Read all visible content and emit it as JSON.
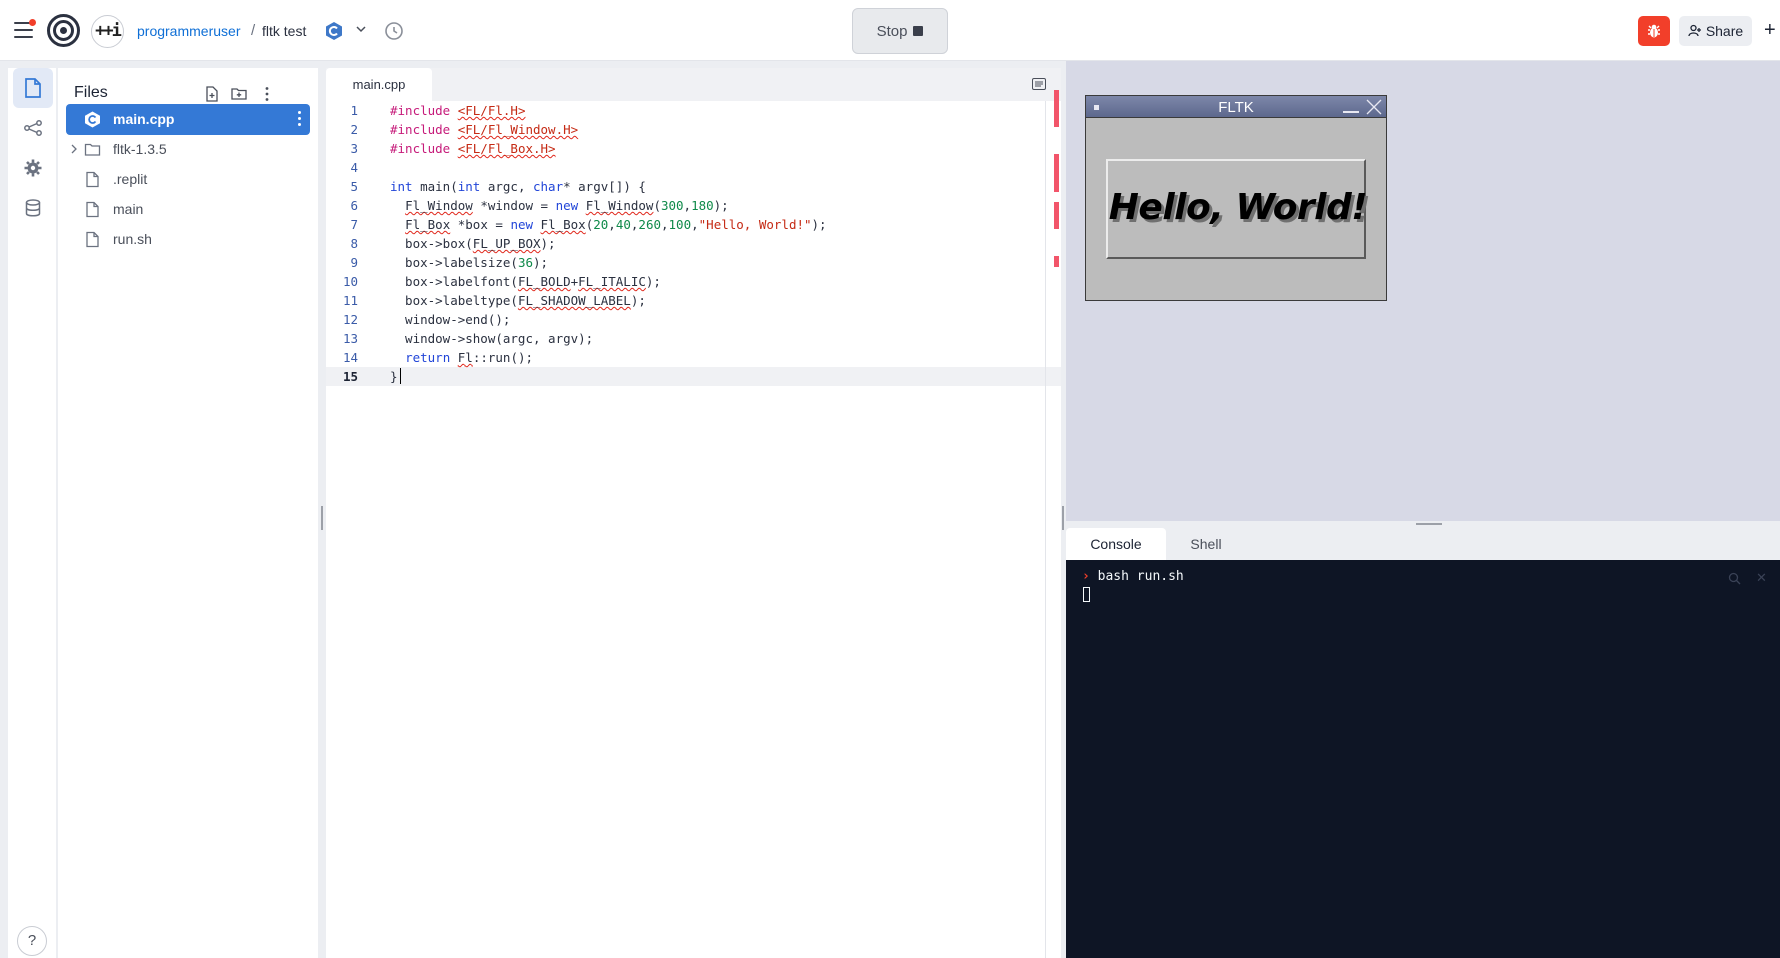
{
  "topbar": {
    "user": "programmeruser",
    "separator": "/",
    "repl_name": "fltk test",
    "lang_badge": "++i",
    "stop_label": "Stop",
    "share_label": "Share",
    "plus": "+"
  },
  "files_panel": {
    "title": "Files",
    "items": [
      {
        "name": "main.cpp",
        "type": "cpp-file",
        "selected": true
      },
      {
        "name": "fltk-1.3.5",
        "type": "folder",
        "selected": false
      },
      {
        "name": ".replit",
        "type": "file",
        "selected": false
      },
      {
        "name": "main",
        "type": "file",
        "selected": false
      },
      {
        "name": "run.sh",
        "type": "file",
        "selected": false
      }
    ]
  },
  "editor": {
    "tab": "main.cpp",
    "line_numbers": [
      "1",
      "2",
      "3",
      "4",
      "5",
      "6",
      "7",
      "8",
      "9",
      "10",
      "11",
      "12",
      "13",
      "14",
      "15"
    ],
    "current_line": 15,
    "lines": [
      "#include <FL/Fl.H>",
      "#include <FL/Fl_Window.H>",
      "#include <FL/Fl_Box.H>",
      "",
      "int main(int argc, char* argv[]) {",
      "  Fl_Window *window = new Fl_Window(300,180);",
      "  Fl_Box *box = new Fl_Box(20,40,260,100,\"Hello, World!\");",
      "  box->box(FL_UP_BOX);",
      "  box->labelsize(36);",
      "  box->labelfont(FL_BOLD+FL_ITALIC);",
      "  box->labeltype(FL_SHADOW_LABEL);",
      "  window->end();",
      "  window->show(argc, argv);",
      "  return Fl::run();",
      "}"
    ]
  },
  "preview": {
    "window_title": "FLTK",
    "label": "Hello, World!"
  },
  "console": {
    "tabs": [
      "Console",
      "Shell"
    ],
    "active_tab": "Console",
    "prompt_symbol": "›",
    "command": "bash run.sh"
  },
  "colors": {
    "accent": "#3479d6",
    "danger": "#f23f2a",
    "terminal_bg": "#0e1525",
    "preview_bg": "#d7d9e6"
  }
}
